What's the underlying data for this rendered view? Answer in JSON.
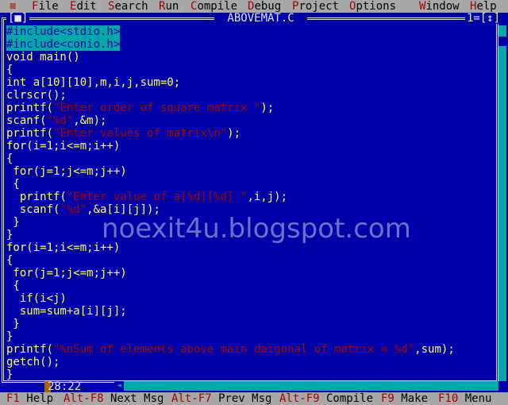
{
  "menubar": {
    "items": [
      {
        "hk": "≡",
        "rest": ""
      },
      {
        "hk": "F",
        "rest": "ile"
      },
      {
        "hk": "E",
        "rest": "dit"
      },
      {
        "hk": "S",
        "rest": "earch"
      },
      {
        "hk": "R",
        "rest": "un"
      },
      {
        "hk": "C",
        "rest": "ompile"
      },
      {
        "hk": "D",
        "rest": "ebug"
      },
      {
        "hk": "P",
        "rest": "roject"
      },
      {
        "hk": "O",
        "rest": "ptions"
      },
      {
        "hk": "W",
        "rest": "indow"
      },
      {
        "hk": "H",
        "rest": "elp"
      }
    ]
  },
  "window": {
    "title": " ABOVEMAT.C ",
    "close": "[■]",
    "number": "1=[↕]"
  },
  "code": [
    [
      {
        "t": "#include<stdio.h>",
        "c": "sel"
      }
    ],
    [
      {
        "t": "#include<conio.h>",
        "c": "sel"
      }
    ],
    [
      {
        "t": "void main()"
      }
    ],
    [
      {
        "t": "{"
      }
    ],
    [
      {
        "t": "int a[10][10],m,i,j,sum=0;"
      }
    ],
    [
      {
        "t": "clrscr();"
      }
    ],
    [
      {
        "t": "printf("
      },
      {
        "t": "\"Enter order of square matrix \"",
        "c": "str"
      },
      {
        "t": ");"
      }
    ],
    [
      {
        "t": "scanf("
      },
      {
        "t": "\"%d\"",
        "c": "str"
      },
      {
        "t": ",&m);"
      }
    ],
    [
      {
        "t": "printf("
      },
      {
        "t": "\"Enter values of matrix\\n\"",
        "c": "str"
      },
      {
        "t": ");"
      }
    ],
    [
      {
        "t": "for(i=1;i<=m;i++)"
      }
    ],
    [
      {
        "t": "{"
      }
    ],
    [
      {
        "t": " for(j=1;j<=m;j++)"
      }
    ],
    [
      {
        "t": " {"
      }
    ],
    [
      {
        "t": "  printf("
      },
      {
        "t": "\"Enter value of a[%d][%d] \"",
        "c": "str"
      },
      {
        "t": ",i,j);"
      }
    ],
    [
      {
        "t": "  scanf("
      },
      {
        "t": "\"%d\"",
        "c": "str"
      },
      {
        "t": ",&a[i][j]);"
      }
    ],
    [
      {
        "t": " }"
      }
    ],
    [
      {
        "t": "}"
      }
    ],
    [
      {
        "t": "for(i=1;i<=m;i++)"
      }
    ],
    [
      {
        "t": "{"
      }
    ],
    [
      {
        "t": " for(j=1;j<=m;j++)"
      }
    ],
    [
      {
        "t": " {"
      }
    ],
    [
      {
        "t": "  if(i<j)"
      }
    ],
    [
      {
        "t": "  sum=sum+a[i][j];"
      }
    ],
    [
      {
        "t": " }"
      }
    ],
    [
      {
        "t": "}"
      }
    ],
    [
      {
        "t": "printf("
      },
      {
        "t": "\"%nSum of elements above main daigonal of matrix = %d\"",
        "c": "str"
      },
      {
        "t": ",sum);"
      }
    ],
    [
      {
        "t": "getch();"
      }
    ],
    [
      {
        "t": "}"
      }
    ]
  ],
  "status": {
    "position": "28:22"
  },
  "watermark": "noexit4u.blogspot.com",
  "hints": [
    {
      "key": "F1",
      "label": " Help"
    },
    {
      "key": "Alt-F8",
      "label": " Next Msg"
    },
    {
      "key": "Alt-F7",
      "label": " Prev Msg"
    },
    {
      "key": "Alt-F9",
      "label": " Compile"
    },
    {
      "key": "F9",
      "label": " Make"
    },
    {
      "key": "F10",
      "label": " Menu"
    }
  ],
  "colors": {
    "editor_bg": "#0000a8",
    "code_text": "#ffff55",
    "string_text": "#a80000",
    "menu_bg": "#a8a8a8",
    "selection_bg": "#00a8a8"
  }
}
